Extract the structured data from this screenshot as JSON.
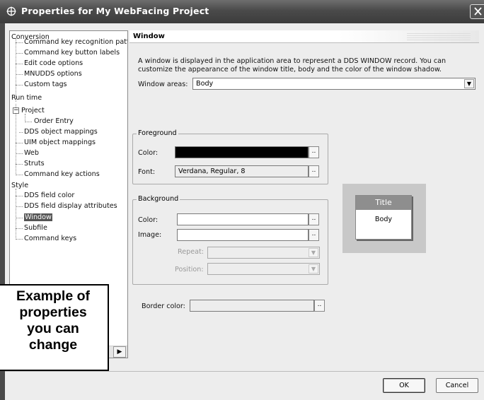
{
  "window": {
    "title": "Properties for My WebFacing Project"
  },
  "tree": {
    "items": [
      "Conversion",
      "Command key recognition patt",
      "Command key button labels",
      "Edit code options",
      "MNUDDS options",
      "Custom tags",
      "Run time",
      "Project",
      "Order Entry",
      "DDS object mappings",
      "UIM object mappings",
      "Web",
      "Struts",
      "Command key actions",
      "Style",
      "DDS field color",
      "DDS field display attributes",
      "Window",
      "Subfile",
      "Command keys"
    ],
    "expander": "−",
    "selected": "Window"
  },
  "panel": {
    "title": "Window",
    "description": "A window is displayed in the application area to represent a DDS WINDOW record.  You can customize the appearance of the window title, body and the color of the window shadow.",
    "window_areas_label": "Window areas:",
    "window_areas_value": "Body"
  },
  "foreground": {
    "legend": "Foreground",
    "color_label": "Color:",
    "font_label": "Font:",
    "font_value": "Verdana, Regular, 8",
    "color_value": "#000000"
  },
  "background": {
    "legend": "Background",
    "color_label": "Color:",
    "image_label": "Image:",
    "repeat_label": "Repeat:",
    "position_label": "Position:"
  },
  "border": {
    "label": "Border color:"
  },
  "preview": {
    "title": "Title",
    "body": "Body"
  },
  "callout": {
    "line1": "Example of",
    "line2": "properties",
    "line3": "you can",
    "line4": "change"
  },
  "buttons": {
    "ok": "OK",
    "cancel": "Cancel",
    "browse": "..",
    "dropdown": "▼",
    "scroll_right": "▶"
  },
  "icons": {
    "app": "webfacing-icon",
    "close": "close-icon"
  }
}
